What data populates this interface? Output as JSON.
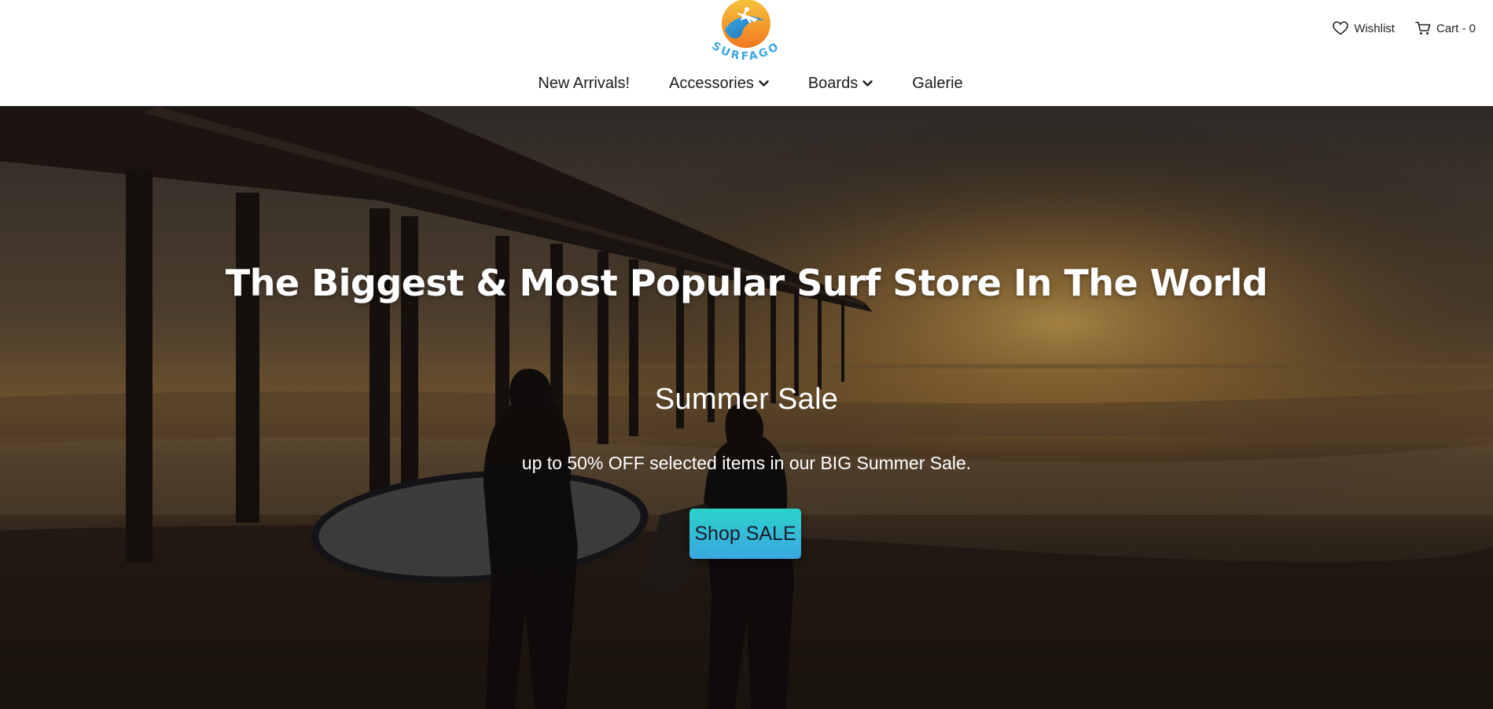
{
  "header": {
    "logo": {
      "text": "SURFAGO",
      "icon": "surfago-logo"
    },
    "actions": {
      "wishlist_label": "Wishlist",
      "cart_label": "Cart - 0"
    },
    "nav": [
      {
        "label": "New Arrivals!",
        "has_dropdown": false
      },
      {
        "label": "Accessories",
        "has_dropdown": true
      },
      {
        "label": "Boards",
        "has_dropdown": true
      },
      {
        "label": "Galerie",
        "has_dropdown": false
      }
    ]
  },
  "hero": {
    "title": "The Biggest & Most Popular Surf Store In The World",
    "subtitle": "Summer Sale",
    "text": "up to 50% OFF selected items in our BIG Summer Sale.",
    "button_label": "Shop SALE",
    "background_image": "surfers-at-pier-sunset"
  },
  "colors": {
    "button_gradient_start": "#2bd3c9",
    "button_gradient_end": "#3aa7e0",
    "logo_orange": "#f39a2c",
    "logo_blue": "#3aa7e0"
  }
}
